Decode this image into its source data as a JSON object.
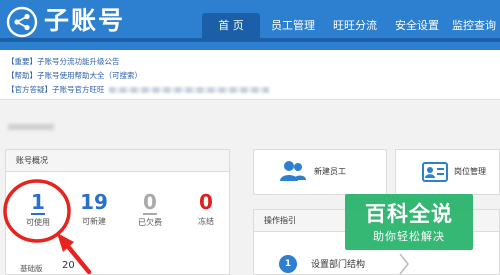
{
  "header": {
    "app_title": "子账号",
    "nav": [
      {
        "label": "首 页",
        "active": true
      },
      {
        "label": "员工管理"
      },
      {
        "label": "旺旺分流"
      },
      {
        "label": "安全设置"
      },
      {
        "label": "监控查询"
      }
    ],
    "icon": "share-network-icon"
  },
  "notices": [
    {
      "text": "【重要】子账号分流功能升级公告"
    },
    {
      "text": "【帮助】子账号使用帮助大全（可搜索）"
    },
    {
      "text": "【官方答疑】子账号官方旺旺"
    }
  ],
  "account_panel": {
    "title": "账号概况",
    "stats": [
      {
        "value": "1",
        "label": "可使用"
      },
      {
        "value": "19",
        "label": "可新建"
      },
      {
        "value": "0",
        "label": "已欠费"
      },
      {
        "value": "0",
        "label": "冻结"
      }
    ],
    "basic_label": "基础版",
    "basic_value": "20"
  },
  "cards": [
    {
      "label": "新建员工",
      "icon": "users-icon"
    },
    {
      "label": "岗位管理",
      "icon": "id-card-icon"
    }
  ],
  "guide": {
    "title": "操作指引",
    "steps": [
      {
        "number": "1",
        "label": "设置部门结构"
      }
    ]
  },
  "watermark": {
    "title": "百科全说",
    "subtitle": "助你轻松解决"
  },
  "colors": {
    "header_blue": "#2d7fd0",
    "nav_active": "#1a5fa8",
    "stat_blue": "#2a6fc9",
    "stat_red": "#e21e1e",
    "annotation_red": "#e8231f",
    "watermark_green": "#26b26a"
  }
}
